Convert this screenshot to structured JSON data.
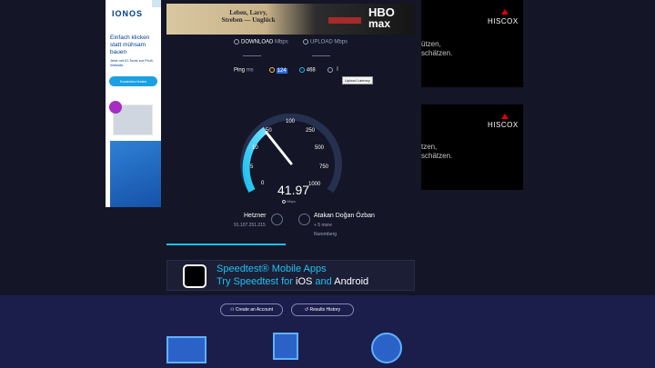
{
  "ad_left": {
    "logo": "IONOS",
    "headline": "Einfach klicken statt mühsam bauen",
    "subtext": "Jetzt mit KI-Tools zur Profi-Website.",
    "button": "Kostenlos testen"
  },
  "ad_top": {
    "headline": "Leben, Larry, Streben — Unglück",
    "brand_line1": "HBO",
    "brand_line2": "max"
  },
  "ad_right": [
    {
      "brand": "HISCOX",
      "text_line1": "ützen,",
      "text_line2": "schätzen."
    },
    {
      "brand": "HISCOX",
      "text_line1": "tzen,",
      "text_line2": "schätzen."
    }
  ],
  "tabs": {
    "download": {
      "label": "DOWNLOAD",
      "unit": "Mbps"
    },
    "upload": {
      "label": "UPLOAD",
      "unit": "Mbps"
    }
  },
  "ping": {
    "label": "Ping",
    "unit": "ms",
    "idle": "124",
    "download": "468",
    "tooltip": "Upload Latency"
  },
  "gauge": {
    "ticks": [
      "0",
      "5",
      "10",
      "50",
      "100",
      "250",
      "500",
      "750",
      "1000"
    ],
    "value": "41.97",
    "unit": "Mbps"
  },
  "server": {
    "isp_name": "Hetzner",
    "isp_ip": "91.107.251.215",
    "host_name": "Atakan Doğan Özban",
    "host_more": "+ 5 more",
    "host_city": "Nuremberg"
  },
  "ad_bottom": {
    "line1": "Speedtest® Mobile Apps",
    "line2_prefix": "Try Speedtest for ",
    "line2_ios": "iOS",
    "line2_and": " and ",
    "line2_android": "Android"
  },
  "lower": {
    "create_account": "Create an Account",
    "results_history": "Results History"
  },
  "colors": {
    "background": "#141526",
    "accent_cyan": "#1ec0f0",
    "lower_band": "#1b1e4a"
  }
}
